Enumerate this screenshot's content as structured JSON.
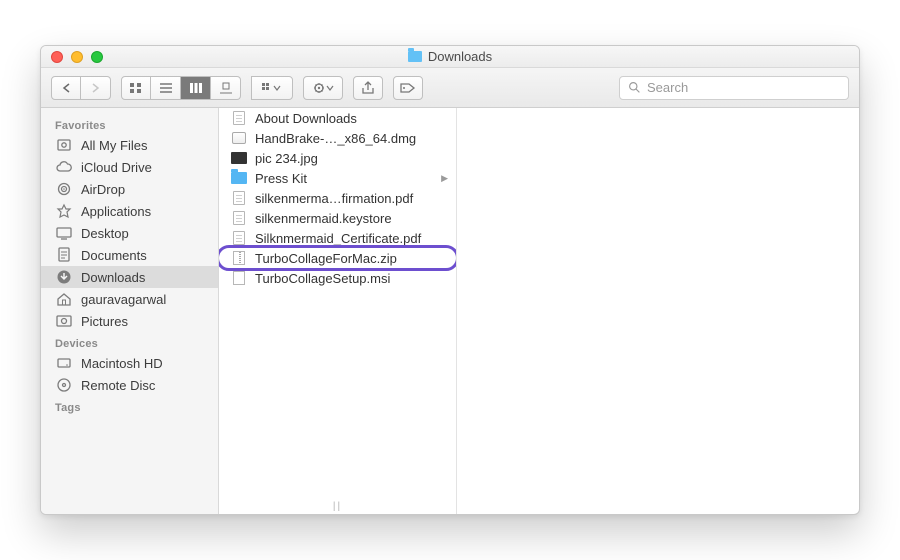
{
  "window": {
    "title": "Downloads"
  },
  "toolbar": {
    "search_placeholder": "Search"
  },
  "sidebar": {
    "sections": [
      {
        "header": "Favorites",
        "items": [
          {
            "id": "allmyfiles",
            "label": "All My Files"
          },
          {
            "id": "icloud",
            "label": "iCloud Drive"
          },
          {
            "id": "airdrop",
            "label": "AirDrop"
          },
          {
            "id": "apps",
            "label": "Applications"
          },
          {
            "id": "desktop",
            "label": "Desktop"
          },
          {
            "id": "documents",
            "label": "Documents"
          },
          {
            "id": "downloads",
            "label": "Downloads",
            "selected": true
          },
          {
            "id": "home",
            "label": "gauravagarwal"
          },
          {
            "id": "pictures",
            "label": "Pictures"
          }
        ]
      },
      {
        "header": "Devices",
        "items": [
          {
            "id": "hd",
            "label": "Macintosh HD"
          },
          {
            "id": "remotedisc",
            "label": "Remote Disc"
          }
        ]
      },
      {
        "header": "Tags",
        "items": []
      }
    ]
  },
  "column": {
    "files": [
      {
        "type": "doc",
        "label": "About Downloads"
      },
      {
        "type": "dmg",
        "label": "HandBrake-…_x86_64.dmg"
      },
      {
        "type": "jpg",
        "label": "pic 234.jpg"
      },
      {
        "type": "fld",
        "label": "Press Kit",
        "has_children": true
      },
      {
        "type": "doc",
        "label": "silkenmerma…firmation.pdf"
      },
      {
        "type": "doc",
        "label": "silkenmermaid.keystore"
      },
      {
        "type": "doc",
        "label": "Silknmermaid_Certificate.pdf"
      },
      {
        "type": "zip",
        "label": "TurboCollageForMac.zip",
        "highlighted": true
      },
      {
        "type": "msi",
        "label": "TurboCollageSetup.msi"
      }
    ]
  }
}
